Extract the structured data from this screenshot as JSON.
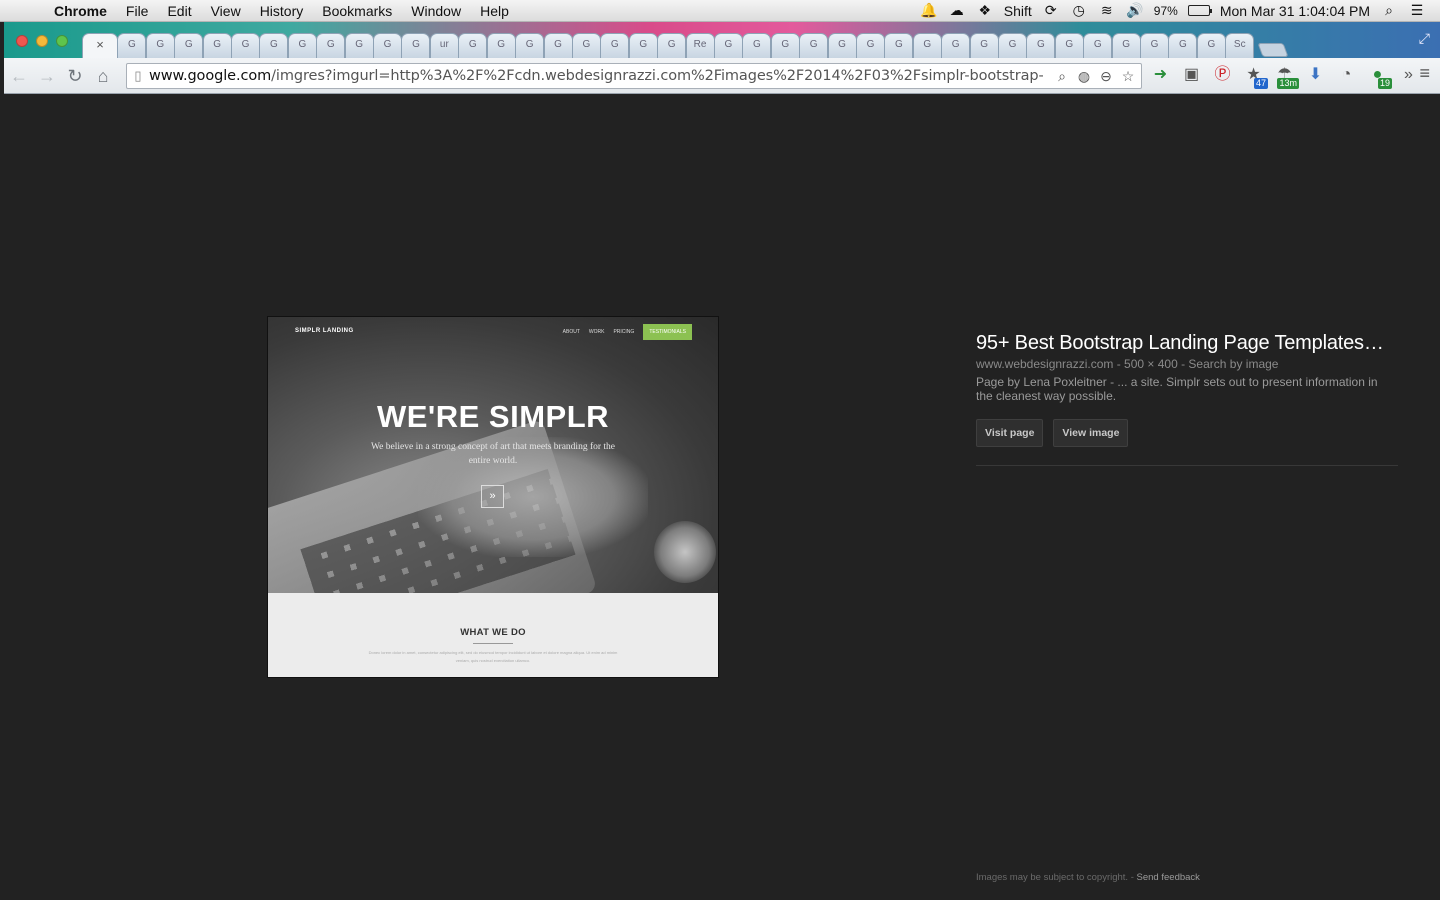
{
  "menubar": {
    "apple_icon": "apple-icon",
    "app_name": "Chrome",
    "menus": [
      "File",
      "Edit",
      "View",
      "History",
      "Bookmarks",
      "Window",
      "Help"
    ],
    "shift_label": "Shift",
    "battery_percent": "97%",
    "battery_level": 0.97,
    "datetime": "Mon Mar 31  1:04:04 PM"
  },
  "tabstrip": {
    "tab_labels": [
      "G",
      "G",
      "G",
      "G",
      "G",
      "G",
      "G",
      "G",
      "G",
      "G",
      "G",
      "ur",
      "G",
      "G",
      "G",
      "G",
      "G",
      "G",
      "G",
      "G",
      "Re",
      "G",
      "G",
      "G",
      "G",
      "G",
      "G",
      "G",
      "G",
      "G",
      "G",
      "G",
      "G",
      "G",
      "G",
      "G",
      "G",
      "G",
      "G",
      "Sc"
    ],
    "active_tab_close": "×"
  },
  "toolbar": {
    "url_host": "www.google.com",
    "url_path": "/imgres?imgurl=http%3A%2F%2Fcdn.webdesignrazzi.com%2Fimages%2F2014%2F03%2Fsimplr-bootstrap-3-res...",
    "extension_badges": {
      "calendar": "47",
      "weather": "13m",
      "evernote": "19"
    }
  },
  "preview": {
    "logo": "SIMPLR LANDING",
    "nav": [
      "ABOUT",
      "WORK",
      "PRICING",
      "TESTIMONIALS"
    ],
    "headline": "WE'RE SIMPLR",
    "tagline": "We believe in a strong concept of art that meets branding for the entire world.",
    "section_title": "WHAT WE DO",
    "section_body": "Donec lorem dolor in amet, consectetur adipiscing elit, sed do eiusmod tempor incididunt ut labore et dolore magna aliqua. Ut enim ad minim veniam, quis nostrud exercitation ullamco."
  },
  "info": {
    "title": "95+ Best Bootstrap Landing Page Templates…",
    "meta": "www.webdesignrazzi.com - 500 × 400 - Search by image",
    "description": "Page by Lena Poxleitner - ... a site. Simplr sets out to present information in the cleanest way possible.",
    "visit_button": "Visit page",
    "view_button": "View image"
  },
  "footer": {
    "copyright": "Images may be subject to copyright. - ",
    "feedback": "Send feedback"
  }
}
